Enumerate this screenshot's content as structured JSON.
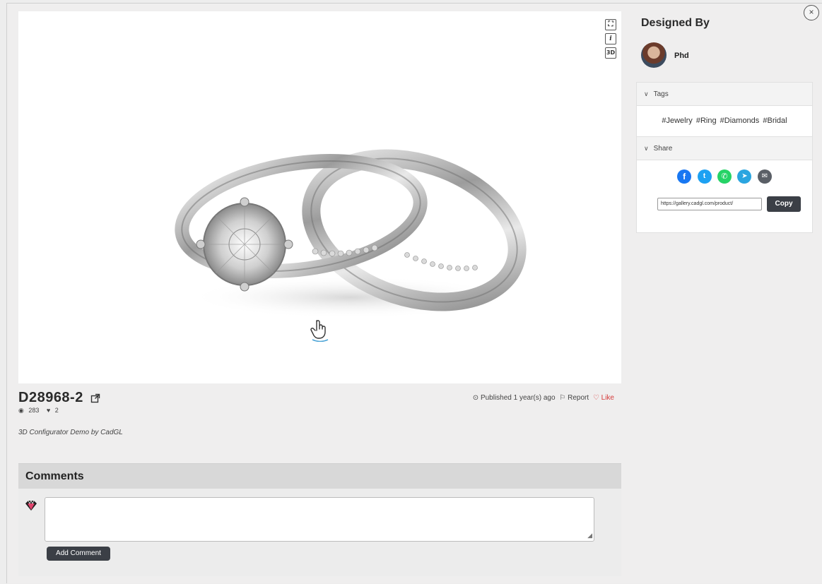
{
  "viewer": {
    "tools": [
      {
        "name": "fullscreen-icon",
        "glyph": "⛶"
      },
      {
        "name": "info-icon",
        "glyph": "i"
      },
      {
        "name": "3d-icon",
        "glyph": "3D"
      }
    ]
  },
  "product": {
    "title": "D28968-2",
    "views": "283",
    "likes": "2",
    "published": "Published 1 year(s) ago",
    "report_label": "Report",
    "like_label": "Like",
    "description": "3D Configurator Demo by CadGL"
  },
  "comments": {
    "header": "Comments",
    "add_label": "Add Comment"
  },
  "sidebar": {
    "close_glyph": "×",
    "designed_by": "Designed By",
    "designer_name": "Phd",
    "tags_label": "Tags",
    "tags": [
      "#Jewelry",
      "#Ring",
      "#Diamonds",
      "#Bridal"
    ],
    "share_label": "Share",
    "share_url": "https://gallery.cadgl.com/product/",
    "copy_label": "Copy"
  },
  "colors": {
    "facebook": "#1877f2",
    "twitter": "#1da1f2",
    "whatsapp": "#25d366",
    "telegram": "#2aa5e0",
    "email": "#5a5f66",
    "like": "#d63b3b",
    "button_dark": "#3b3f46"
  }
}
